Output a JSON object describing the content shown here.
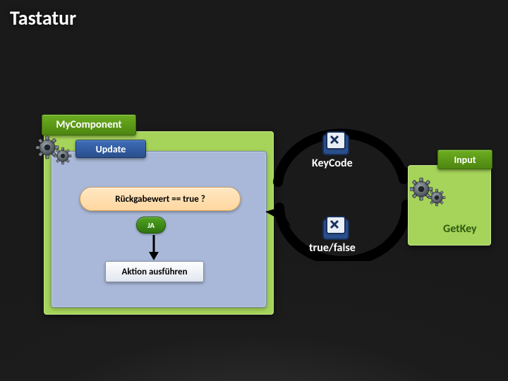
{
  "title": "Tastatur",
  "component": {
    "tag": "MyComponent",
    "update_tag": "Update",
    "decision": "Rückgabewert == true ?",
    "yes": "JA",
    "action": "Aktion ausführen"
  },
  "input_panel": {
    "tag": "Input",
    "method": "GetKey"
  },
  "flow": {
    "param": "KeyCode",
    "result": "true/false"
  },
  "icons": {
    "gears": "gears-icon",
    "keycap": "keycap-icon"
  },
  "colors": {
    "panel_green": "#a6d45a",
    "tag_green": "#5c9a17",
    "tag_blue": "#2f5a9a",
    "pill": "#ffd7a0"
  }
}
